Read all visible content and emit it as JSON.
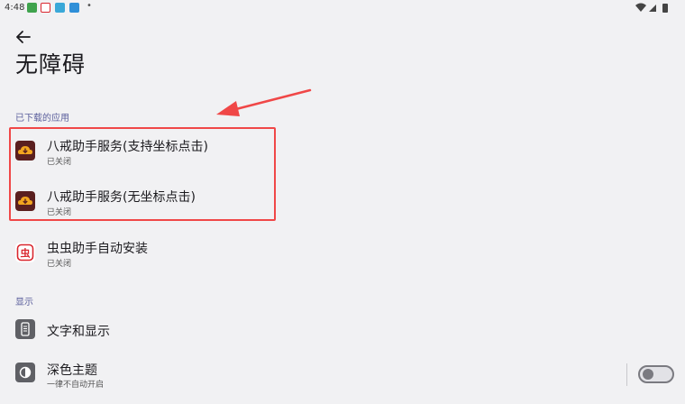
{
  "status_bar": {
    "time": "4:48",
    "notification_icons": [
      "app-notification-icon",
      "chongchong-notification-icon",
      "app-notification-icon",
      "app-notification-icon"
    ],
    "notification_dot": "•",
    "system_icons": [
      "wifi-icon",
      "cellular-icon",
      "battery-icon"
    ]
  },
  "header": {
    "title": "无障碍"
  },
  "sections": {
    "downloaded_apps": {
      "header": "已下载的应用",
      "items": [
        {
          "label": "八戒助手服务(支持坐标点击)",
          "status": "已关闭",
          "icon": "bajie-cloud-icon"
        },
        {
          "label": "八戒助手服务(无坐标点击)",
          "status": "已关闭",
          "icon": "bajie-cloud-icon"
        },
        {
          "label": "虫虫助手自动安装",
          "status": "已关闭",
          "icon": "chongchong-app-icon"
        }
      ]
    },
    "display": {
      "header": "显示",
      "items": [
        {
          "label": "文字和显示",
          "icon": "text-display-icon"
        },
        {
          "label": "深色主题",
          "status": "一律不自动开启",
          "icon": "dark-theme-icon",
          "toggle_on": false
        }
      ]
    }
  },
  "colors": {
    "highlight": "#f04747",
    "bajie_icon_bg": "#5a1f1f",
    "bajie_icon_cloud": "#f2a51f",
    "chongchong_red": "#d9262e",
    "section_header": "#5b5f9c"
  }
}
